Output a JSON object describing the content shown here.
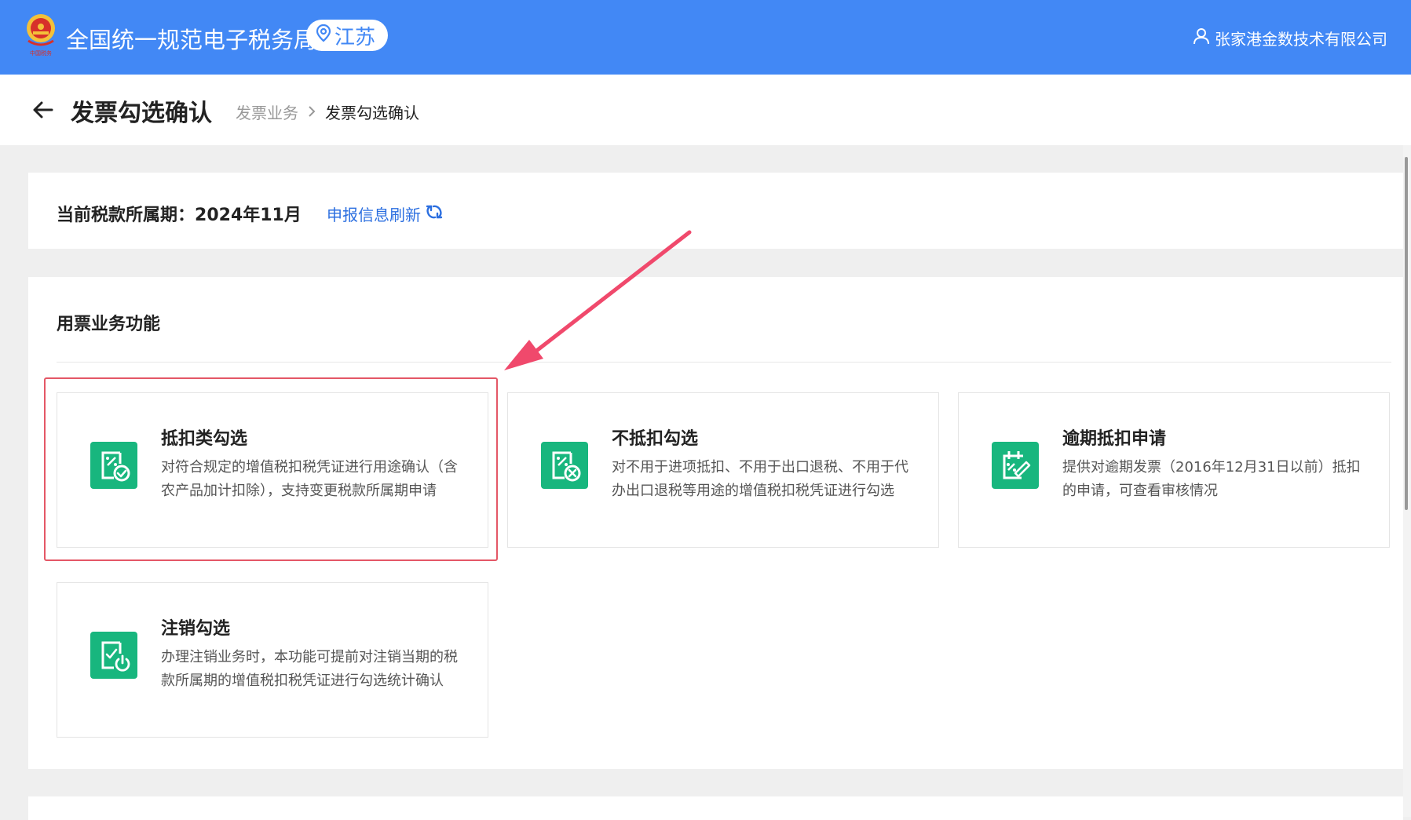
{
  "header": {
    "title": "全国统一规范电子税务局",
    "region": "江苏",
    "user": "张家港金数技术有限公司",
    "brand_color": "#4288f5"
  },
  "subheader": {
    "title": "发票勾选确认",
    "breadcrumb": [
      "发票业务",
      "发票勾选确认"
    ]
  },
  "period": {
    "label": "当前税款所属期：",
    "value": "2024年11月",
    "refresh_label": "申报信息刷新"
  },
  "functions": {
    "section_title": "用票业务功能",
    "accent_color": "#18b67e",
    "cards": [
      {
        "title": "抵扣类勾选",
        "desc": "对符合规定的增值税扣税凭证进行用途确认（含农产品加计扣除），支持变更税款所属期申请",
        "icon": "invoice-check-icon"
      },
      {
        "title": "不抵扣勾选",
        "desc": "对不用于进项抵扣、不用于出口退税、不用于代办出口退税等用途的增值税扣税凭证进行勾选",
        "icon": "invoice-cancel-icon"
      },
      {
        "title": "逾期抵扣申请",
        "desc": "提供对逾期发票（2016年12月31日以前）抵扣的申请，可查看审核情况",
        "icon": "calendar-edit-icon"
      },
      {
        "title": "注销勾选",
        "desc": "办理注销业务时，本功能可提前对注销当期的税款所属期的增值税扣税凭证进行勾选统计确认",
        "icon": "document-power-icon"
      }
    ]
  },
  "annotation": {
    "highlight_color": "#e45766"
  }
}
